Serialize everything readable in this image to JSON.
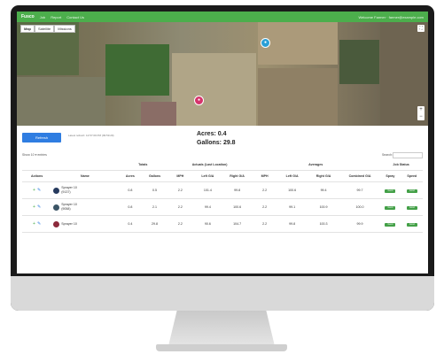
{
  "nav": {
    "brand": "Fusco",
    "links": [
      "Job",
      "Report",
      "Contact Us"
    ],
    "user": "Welcome Farmer · farmer@example.com"
  },
  "map": {
    "types": [
      "Map",
      "Satellite",
      "Missions"
    ],
    "zoom_in": "+",
    "zoom_out": "−"
  },
  "toolbar": {
    "refresh_label": "Refresh",
    "last_refresh": "Latest refresh: 12:57:09 PM (09:59:29)"
  },
  "summary": {
    "acres": "Acres: 0.4",
    "gallons": "Gallons: 29.8"
  },
  "table_controls": {
    "show": "Show 10 ▾ entries",
    "search": "Search:"
  },
  "groups": {
    "totals": "Totals",
    "actuals": "Actuals (Last Location)",
    "averages": "Averages",
    "job_status": "Job Status"
  },
  "columns": [
    "Actions",
    "Name",
    "Acres",
    "Gallons",
    "MPH",
    "Left G/A",
    "Right G/A",
    "MPH",
    "Left G/A",
    "Right G/A",
    "Combined G/A",
    "Spray",
    "Speed"
  ],
  "rows": [
    {
      "name": "Sprayer 10",
      "id": "(9137)",
      "acres": "0.8",
      "gallons": "0.5",
      "mph": "2.2",
      "left_ga": "101.4",
      "right_ga": "99.8",
      "avg_mph": "2.2",
      "avg_left": "100.6",
      "avg_right": "99.4",
      "combined": "99.7",
      "spray": "Good",
      "speed": "Good"
    },
    {
      "name": "Sprayer 10",
      "id": "(9058)",
      "acres": "0.8",
      "gallons": "2.1",
      "mph": "2.2",
      "left_ga": "99.4",
      "right_ga": "100.6",
      "avg_mph": "2.2",
      "avg_left": "99.1",
      "avg_right": "100.9",
      "combined": "100.0",
      "spray": "Good",
      "speed": "Good"
    },
    {
      "name": "Sprayer 10",
      "id": "",
      "acres": "0.4",
      "gallons": "29.8",
      "mph": "2.2",
      "left_ga": "90.6",
      "right_ga": "104.7",
      "avg_mph": "2.2",
      "avg_left": "99.8",
      "avg_right": "100.3",
      "combined": "99.9",
      "spray": "Good",
      "speed": "Good"
    }
  ],
  "colors": {
    "nav": "#4cae4c",
    "refresh": "#2f7de1",
    "status_good": "#43a047",
    "sprayer_icons": [
      "#263a5e",
      "#3c5566",
      "#8c2a3c"
    ]
  }
}
